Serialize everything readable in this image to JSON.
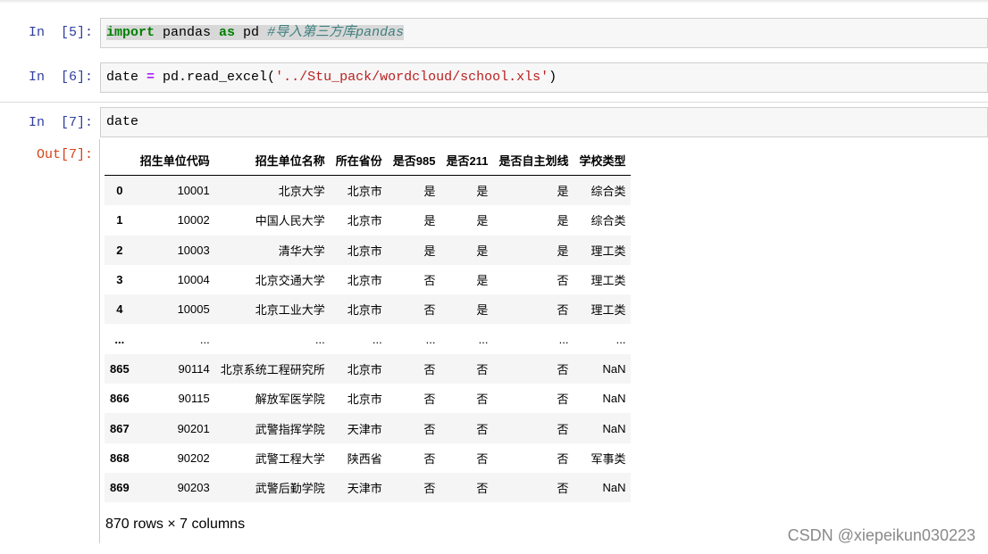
{
  "cells": [
    {
      "prompt": "In  [5]:",
      "tokens": [
        {
          "t": "import",
          "c": "kw"
        },
        {
          "t": " pandas ",
          "c": ""
        },
        {
          "t": "as",
          "c": "kw"
        },
        {
          "t": " pd ",
          "c": ""
        },
        {
          "t": "#导入第三方库pandas",
          "c": "cm"
        }
      ]
    },
    {
      "prompt": "In  [6]:",
      "tokens": [
        {
          "t": "date ",
          "c": ""
        },
        {
          "t": "=",
          "c": "op"
        },
        {
          "t": " pd.read_excel(",
          "c": ""
        },
        {
          "t": "'../Stu_pack/wordcloud/school.xls'",
          "c": "str"
        },
        {
          "t": ")",
          "c": ""
        }
      ]
    },
    {
      "prompt": "In  [7]:",
      "tokens": [
        {
          "t": "date",
          "c": ""
        }
      ]
    }
  ],
  "output_prompt": "Out[7]:",
  "dataframe": {
    "columns": [
      "",
      "招生单位代码",
      "招生单位名称",
      "所在省份",
      "是否985",
      "是否211",
      "是否自主划线",
      "学校类型"
    ],
    "rows": [
      [
        "0",
        "10001",
        "北京大学",
        "北京市",
        "是",
        "是",
        "是",
        "综合类"
      ],
      [
        "1",
        "10002",
        "中国人民大学",
        "北京市",
        "是",
        "是",
        "是",
        "综合类"
      ],
      [
        "2",
        "10003",
        "清华大学",
        "北京市",
        "是",
        "是",
        "是",
        "理工类"
      ],
      [
        "3",
        "10004",
        "北京交通大学",
        "北京市",
        "否",
        "是",
        "否",
        "理工类"
      ],
      [
        "4",
        "10005",
        "北京工业大学",
        "北京市",
        "否",
        "是",
        "否",
        "理工类"
      ],
      [
        "...",
        "...",
        "...",
        "...",
        "...",
        "...",
        "...",
        "..."
      ],
      [
        "865",
        "90114",
        "北京系统工程研究所",
        "北京市",
        "否",
        "否",
        "否",
        "NaN"
      ],
      [
        "866",
        "90115",
        "解放军医学院",
        "北京市",
        "否",
        "否",
        "否",
        "NaN"
      ],
      [
        "867",
        "90201",
        "武警指挥学院",
        "天津市",
        "否",
        "否",
        "否",
        "NaN"
      ],
      [
        "868",
        "90202",
        "武警工程大学",
        "陕西省",
        "否",
        "否",
        "否",
        "军事类"
      ],
      [
        "869",
        "90203",
        "武警后勤学院",
        "天津市",
        "否",
        "否",
        "否",
        "NaN"
      ]
    ],
    "shape_text": "870 rows × 7 columns"
  },
  "watermark": "CSDN @xiepeikun030223"
}
